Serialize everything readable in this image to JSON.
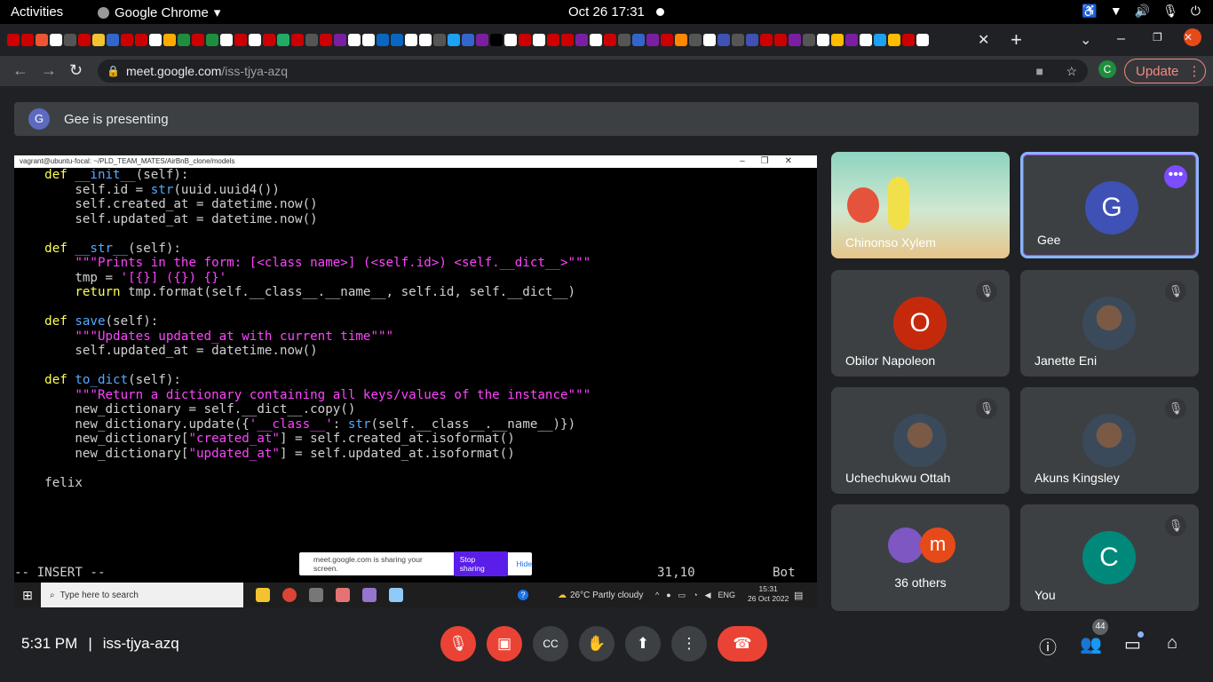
{
  "system_bar": {
    "activities": "Activities",
    "app_name": "Google Chrome",
    "clock": "Oct 26  17:31"
  },
  "browser": {
    "url_host": "meet.google.com",
    "url_path": "/iss-tjya-azq",
    "profile_letter": "C",
    "update_label": "Update"
  },
  "presenting": {
    "avatar_letter": "G",
    "text": "Gee is presenting"
  },
  "terminal": {
    "title": "vagrant@ubuntu-focal: ~/PLD_TEAM_MATES/AirBnB_clone/models",
    "lines": [
      [
        [
          "    ",
          ""
        ],
        [
          "def",
          "kw"
        ],
        [
          " ",
          ""
        ],
        [
          "__init__",
          "fn"
        ],
        [
          "(self):",
          ""
        ]
      ],
      [
        [
          "        self.id = ",
          ""
        ],
        [
          "str",
          "fn"
        ],
        [
          "(uuid.uuid4())",
          ""
        ]
      ],
      [
        [
          "        self.created_at = datetime.now()",
          ""
        ]
      ],
      [
        [
          "        self.updated_at = datetime.now()",
          ""
        ]
      ],
      [
        [
          "",
          ""
        ]
      ],
      [
        [
          "    ",
          ""
        ],
        [
          "def",
          "kw"
        ],
        [
          " ",
          ""
        ],
        [
          "__str__",
          "fn"
        ],
        [
          "(self):",
          ""
        ]
      ],
      [
        [
          "        ",
          ""
        ],
        [
          "\"\"\"Prints in the form: [<class name>] (<self.id>) <self.__dict__>\"\"\"",
          "st"
        ]
      ],
      [
        [
          "        tmp = ",
          ""
        ],
        [
          "'[{}] ({}) {}'",
          "st"
        ]
      ],
      [
        [
          "        ",
          ""
        ],
        [
          "return",
          "kw"
        ],
        [
          " tmp.format(self.__class__.__name__, self.id, self.__dict__)",
          ""
        ]
      ],
      [
        [
          "",
          ""
        ]
      ],
      [
        [
          "    ",
          ""
        ],
        [
          "def",
          "kw"
        ],
        [
          " ",
          ""
        ],
        [
          "save",
          "fn"
        ],
        [
          "(self):",
          ""
        ]
      ],
      [
        [
          "        ",
          ""
        ],
        [
          "\"\"\"Updates updated_at with current time\"\"\"",
          "st"
        ]
      ],
      [
        [
          "        self.updated_at = datetime.now()",
          ""
        ]
      ],
      [
        [
          "",
          ""
        ]
      ],
      [
        [
          "    ",
          ""
        ],
        [
          "def",
          "kw"
        ],
        [
          " ",
          ""
        ],
        [
          "to_dict",
          "fn"
        ],
        [
          "(self):",
          ""
        ]
      ],
      [
        [
          "        ",
          ""
        ],
        [
          "\"\"\"Return a dictionary containing all keys/values of the instance\"\"\"",
          "st"
        ]
      ],
      [
        [
          "        new_dictionary = self.__dict__.copy()",
          ""
        ]
      ],
      [
        [
          "        new_dictionary.update({",
          ""
        ],
        [
          "'__class__'",
          "st"
        ],
        [
          ": ",
          ""
        ],
        [
          "str",
          "fn"
        ],
        [
          "(self.__class__.__name__)})",
          ""
        ]
      ],
      [
        [
          "        new_dictionary[",
          ""
        ],
        [
          "\"created_at\"",
          "st"
        ],
        [
          "] = self.created_at.isoformat()",
          ""
        ]
      ],
      [
        [
          "        new_dictionary[",
          ""
        ],
        [
          "\"updated_at\"",
          "st"
        ],
        [
          "] = self.updated_at.isoformat()",
          ""
        ]
      ],
      [
        [
          "",
          ""
        ]
      ],
      [
        [
          "    felix",
          ""
        ]
      ]
    ],
    "mode": "-- INSERT --",
    "position": "31,10",
    "scroll": "Bot"
  },
  "share_bar": {
    "text": "meet.google.com is sharing your screen.",
    "stop": "Stop sharing",
    "hide": "Hide"
  },
  "windows_taskbar": {
    "search_placeholder": "Type here to search",
    "weather": "26°C  Partly cloudy",
    "lang": "ENG",
    "time": "15:31",
    "date": "26 Oct 2022"
  },
  "participants": [
    {
      "name": "Chinonso Xylem",
      "type": "video"
    },
    {
      "name": "Gee",
      "letter": "G",
      "color": "#3f51b5",
      "type": "avatar"
    },
    {
      "name": "Obilor Napoleon",
      "letter": "O",
      "color": "#c5290c",
      "type": "avatar"
    },
    {
      "name": "Janette Eni",
      "type": "photo"
    },
    {
      "name": "Uchechukwu Ottah",
      "type": "photo"
    },
    {
      "name": "Akuns Kingsley",
      "type": "photo"
    },
    {
      "name": "36 others",
      "type": "others"
    },
    {
      "name": "You",
      "letter": "C",
      "color": "#00897b",
      "type": "avatar"
    }
  ],
  "bottom": {
    "time": "5:31 PM",
    "meeting_code": "iss-tjya-azq",
    "people_count": "44"
  }
}
